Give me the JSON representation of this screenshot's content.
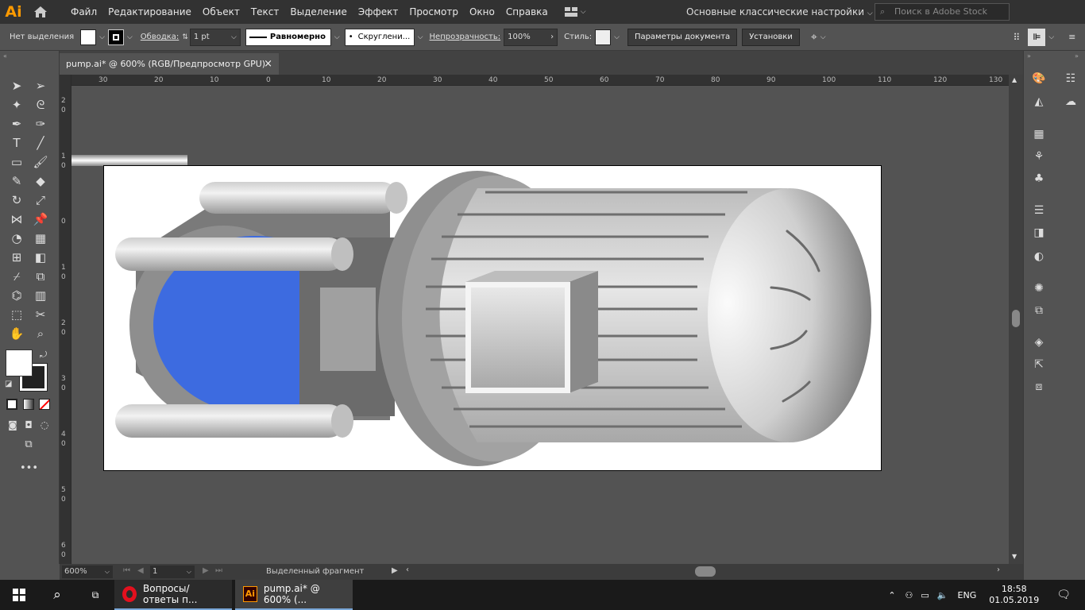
{
  "app": {
    "logo": "Ai",
    "home_icon": "home-icon"
  },
  "menu": [
    "Файл",
    "Редактирование",
    "Объект",
    "Текст",
    "Выделение",
    "Эффект",
    "Просмотр",
    "Окно",
    "Справка"
  ],
  "workspace": "Основные классические настройки",
  "stock_placeholder": "Поиск в Adobe Stock",
  "control": {
    "selection": "Нет выделения",
    "stroke_label": "Обводка:",
    "stroke_value": "1 pt",
    "stroke_profile": "Равномерно",
    "brush": "Скруглени...",
    "opacity_label": "Непрозрачность:",
    "opacity_value": "100%",
    "style_label": "Стиль:",
    "doc_settings": "Параметры документа",
    "prefs": "Установки"
  },
  "tab": {
    "title": "pump.ai* @ 600% (RGB/Предпросмотр GPU)",
    "close": "×"
  },
  "ruler_h": [
    "30",
    "20",
    "10",
    "0",
    "10",
    "20",
    "30",
    "40",
    "50",
    "60",
    "70",
    "80",
    "90",
    "100",
    "110",
    "120",
    "130"
  ],
  "ruler_v": [
    "2",
    "0",
    "1",
    "0",
    "0",
    "1",
    "0",
    "2",
    "0",
    "3",
    "0",
    "4",
    "0",
    "5",
    "0",
    "6",
    "0"
  ],
  "status": {
    "zoom": "600%",
    "artboard": "1",
    "info": "Выделенный фрагмент"
  },
  "taskbar": {
    "opera": "Вопросы/ответы п...",
    "ai": "pump.ai* @ 600% (...",
    "lang": "ENG",
    "time": "18:58",
    "date": "01.05.2019"
  },
  "colors": {
    "fill": "#ffffff",
    "blue": "#3d6be0",
    "accent": "#ff9a00"
  }
}
